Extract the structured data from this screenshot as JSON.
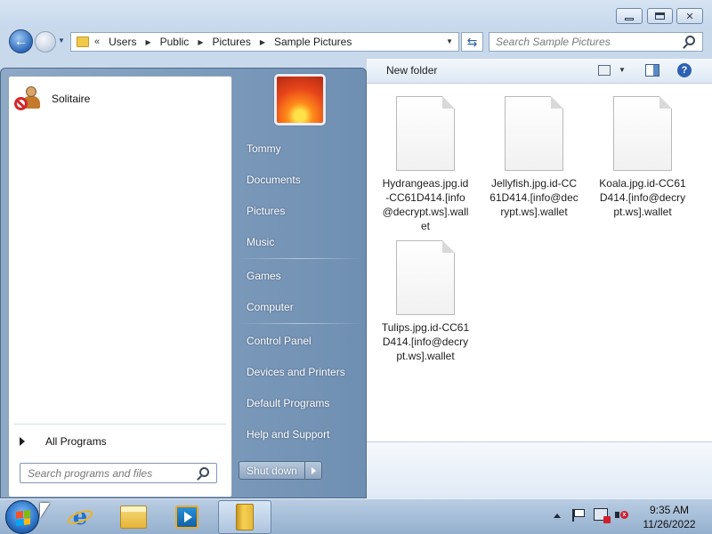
{
  "explorer": {
    "address": {
      "overflow": "«",
      "crumbs": [
        "Users",
        "Public",
        "Pictures",
        "Sample Pictures"
      ]
    },
    "search_placeholder": "Search Sample Pictures",
    "toolbar": {
      "new_folder": "New folder"
    },
    "files": [
      {
        "name": "Hydrangeas.jpg.id-CC61D414.[info@decrypt.ws].wallet"
      },
      {
        "name": "Jellyfish.jpg.id-CC61D414.[info@decrypt.ws].wallet"
      },
      {
        "name": "Koala.jpg.id-CC61D414.[info@decrypt.ws].wallet"
      },
      {
        "name": "Tulips.jpg.id-CC61D414.[info@decrypt.ws].wallet"
      }
    ]
  },
  "start_menu": {
    "pinned": [
      {
        "label": "Solitaire",
        "icon": "solitaire-icon"
      }
    ],
    "all_programs": "All Programs",
    "search_placeholder": "Search programs and files",
    "right_items": [
      "Tommy",
      "Documents",
      "Pictures",
      "Music",
      "Games",
      "Computer",
      "Control Panel",
      "Devices and Printers",
      "Default Programs",
      "Help and Support"
    ],
    "shutdown_label": "Shut down"
  },
  "taskbar": {
    "pinned": [
      "internet-explorer-icon",
      "windows-explorer-icon",
      "media-player-icon",
      "folder-icon"
    ],
    "clock": {
      "time": "9:35 AM",
      "date": "11/26/2022"
    }
  }
}
